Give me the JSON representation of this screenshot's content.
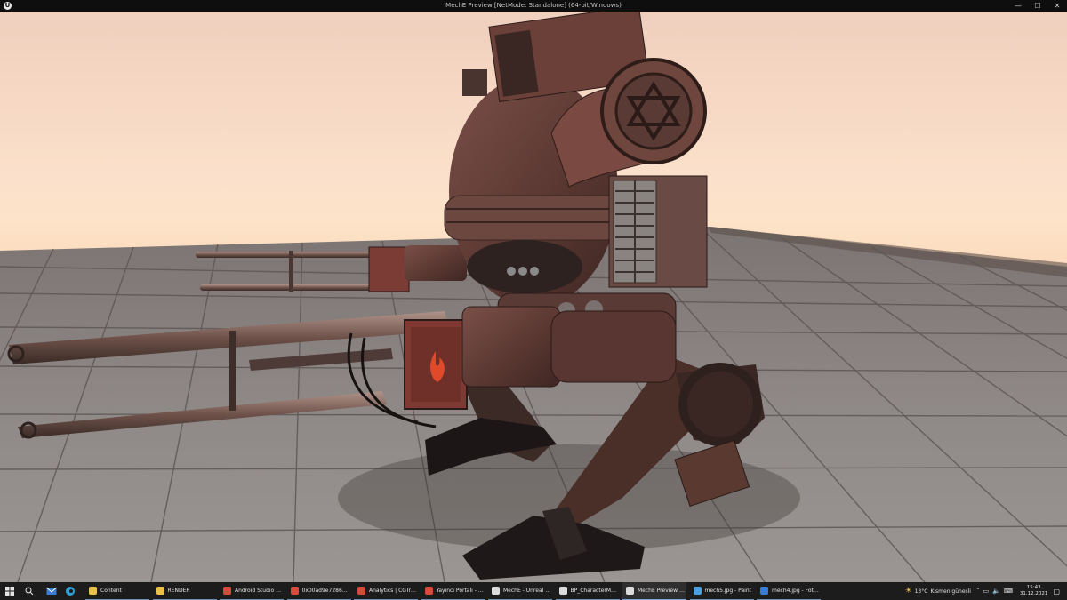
{
  "window": {
    "title": "MechE Preview [NetMode: Standalone]  (64-bit/Windows)",
    "logo_letter": "U",
    "close_glyph": "✕",
    "minimize_glyph": "—",
    "maximize_glyph": "☐"
  },
  "taskbar": {
    "apps": [
      {
        "label": "Content",
        "icon": "folder-icon",
        "color": "#e8c04a"
      },
      {
        "label": "RENDER",
        "icon": "folder-icon",
        "color": "#e8c04a"
      },
      {
        "label": "Android Studio Der...",
        "icon": "chrome-icon",
        "color": "#d94a3a"
      },
      {
        "label": "0x00ad9e7286914ef...",
        "icon": "chrome-icon",
        "color": "#d94a3a"
      },
      {
        "label": "Analytics | CGTrade...",
        "icon": "chrome-icon",
        "color": "#d94a3a"
      },
      {
        "label": "Yayıncı Portalı - Go...",
        "icon": "chrome-icon",
        "color": "#d94a3a"
      },
      {
        "label": "MechE - Unreal Edi...",
        "icon": "unreal-icon",
        "color": "#dcdcdc"
      },
      {
        "label": "BP_CharacterMech_E",
        "icon": "unreal-icon",
        "color": "#dcdcdc"
      },
      {
        "label": "MechE Preview (Ne...",
        "icon": "unreal-icon",
        "color": "#dcdcdc"
      },
      {
        "label": "mech5.jpg - Paint",
        "icon": "paint-icon",
        "color": "#4aa0e0"
      },
      {
        "label": "mech4.jpg - Fotoğr...",
        "icon": "photos-icon",
        "color": "#3a7bd5"
      }
    ],
    "weather_temp": "13°C",
    "weather_text": "Kısmen güneşli",
    "time": "15:43",
    "date": "31.12.2021"
  }
}
